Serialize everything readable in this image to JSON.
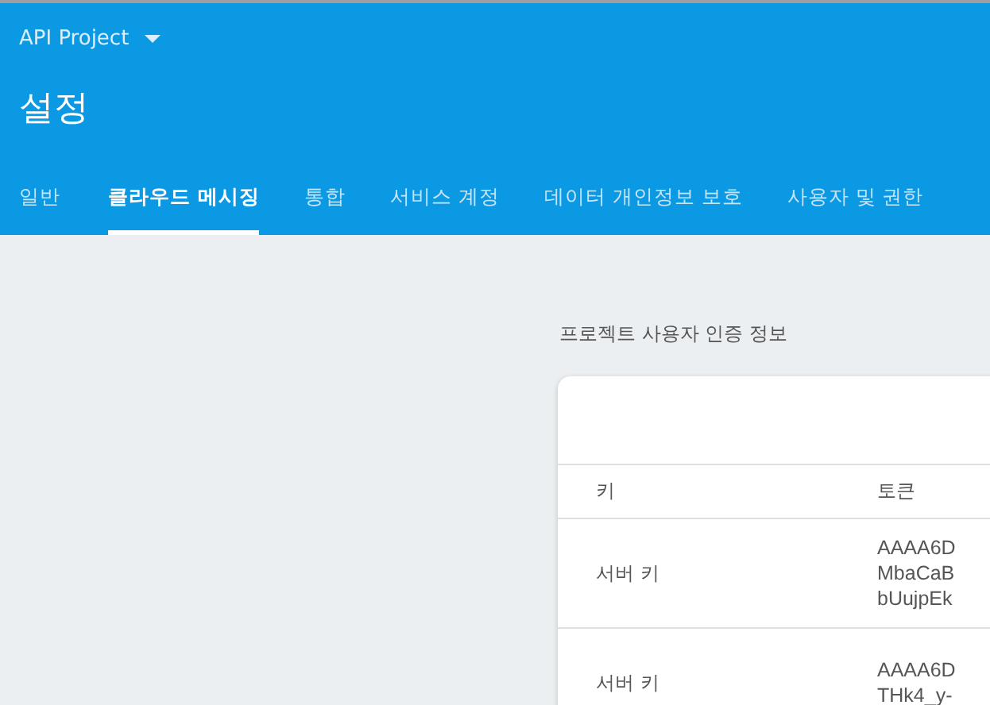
{
  "project": {
    "name": "API Project"
  },
  "title": "설정",
  "tabs": [
    {
      "label": "일반",
      "selected": false
    },
    {
      "label": "클라우드 메시징",
      "selected": true
    },
    {
      "label": "통합",
      "selected": false
    },
    {
      "label": "서비스 계정",
      "selected": false
    },
    {
      "label": "데이터 개인정보 보호",
      "selected": false
    },
    {
      "label": "사용자 및 권한",
      "selected": false
    }
  ],
  "section_title": "프로젝트 사용자 인증 정보",
  "table": {
    "columns": [
      "키",
      "토큰"
    ],
    "rows": [
      {
        "key": "서버 키",
        "token": [
          "AAAA6D",
          "MbaCaB",
          "bUujpEk"
        ]
      },
      {
        "key": "서버 키",
        "token": [
          "AAAA6D",
          "THk4_y-"
        ]
      }
    ]
  }
}
